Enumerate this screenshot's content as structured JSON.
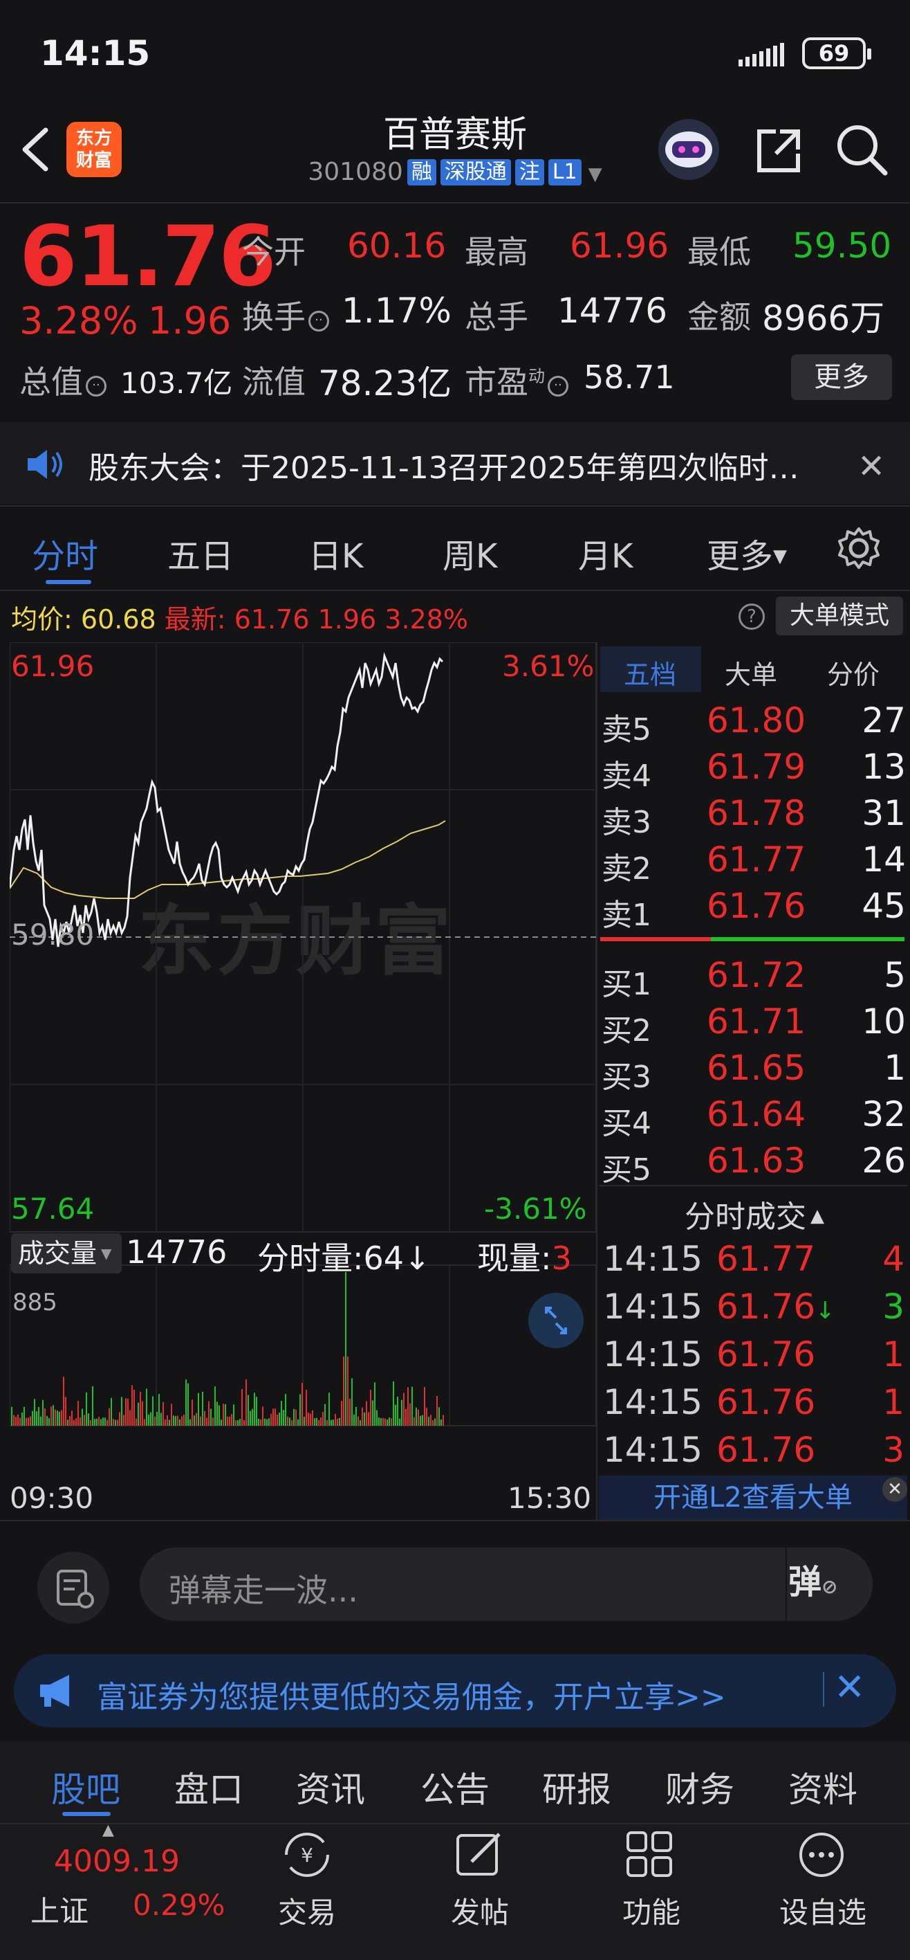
{
  "status_bar": {
    "time": "14:15",
    "battery": "69"
  },
  "header": {
    "title": "百普赛斯",
    "code": "301080",
    "tags": [
      "融",
      "深股通",
      "注",
      "L1"
    ],
    "logo_line1": "东方",
    "logo_line2": "财富"
  },
  "quote": {
    "price": "61.76",
    "change_pct": "3.28%",
    "change_amt": "1.96",
    "open_label": "今开",
    "open": "60.16",
    "high_label": "最高",
    "high": "61.96",
    "low_label": "最低",
    "low": "59.50",
    "turnover_label": "换手",
    "turnover": "1.17%",
    "volume_label": "总手",
    "volume": "14776",
    "amount_label": "金额",
    "amount": "8966万",
    "mktcap_label": "总值",
    "mktcap": "103.7亿",
    "float_label": "流值",
    "float": "78.23亿",
    "pe_label": "市盈",
    "pe_sup": "动",
    "pe": "58.71",
    "more": "更多"
  },
  "notice": {
    "text": "股东大会：于2025-11-13召开2025年第四次临时…"
  },
  "tabs": [
    "分时",
    "五日",
    "日K",
    "周K",
    "月K",
    "更多"
  ],
  "chart_bar": {
    "avg_label": "均价:",
    "avg": "60.68",
    "latest_label": "最新:",
    "latest": "61.76",
    "latest_chg": "1.96",
    "latest_pct": "3.28%",
    "big_order_mode": "大单模式"
  },
  "chart_axis": {
    "top_price": "61.96",
    "top_pct": "3.61%",
    "mid_price": "59.80",
    "bottom_price": "57.64",
    "bottom_pct": "-3.61%",
    "watermark": "东方财富",
    "vol_max": "885",
    "time_start": "09:30",
    "time_end": "15:30"
  },
  "vol_bar": {
    "selector": "成交量",
    "total": "14776",
    "minute_label": "分时量:64↓",
    "now_label": "现量:",
    "now": "3"
  },
  "orderbook": {
    "tabs": [
      "五档",
      "大单",
      "分价"
    ],
    "asks": [
      {
        "label": "卖5",
        "price": "61.80",
        "vol": "27"
      },
      {
        "label": "卖4",
        "price": "61.79",
        "vol": "13"
      },
      {
        "label": "卖3",
        "price": "61.78",
        "vol": "31"
      },
      {
        "label": "卖2",
        "price": "61.77",
        "vol": "14"
      },
      {
        "label": "卖1",
        "price": "61.76",
        "vol": "45"
      }
    ],
    "bids": [
      {
        "label": "买1",
        "price": "61.72",
        "vol": "5"
      },
      {
        "label": "买2",
        "price": "61.71",
        "vol": "10"
      },
      {
        "label": "买3",
        "price": "61.65",
        "vol": "1"
      },
      {
        "label": "买4",
        "price": "61.64",
        "vol": "32"
      },
      {
        "label": "买5",
        "price": "61.63",
        "vol": "26"
      }
    ],
    "ticks_title": "分时成交",
    "ticks": [
      {
        "time": "14:15",
        "price": "61.77",
        "vol": "4",
        "dir": ""
      },
      {
        "time": "14:15",
        "price": "61.76",
        "vol": "3",
        "dir": "↓"
      },
      {
        "time": "14:15",
        "price": "61.76",
        "vol": "1",
        "dir": ""
      },
      {
        "time": "14:15",
        "price": "61.76",
        "vol": "1",
        "dir": ""
      },
      {
        "time": "14:15",
        "price": "61.76",
        "vol": "3",
        "dir": ""
      }
    ],
    "l2_cta": "开通L2查看大单"
  },
  "comment": {
    "placeholder": "弹幕走一波...",
    "danmu": "弹"
  },
  "promo": {
    "text": "富证券为您提供更低的交易佣金，开户立享>>"
  },
  "bottom_tabs": [
    "股吧",
    "盘口",
    "资讯",
    "公告",
    "研报",
    "财务",
    "资料"
  ],
  "bottom_nav": {
    "index_value": "4009.19",
    "index_name": "上证",
    "index_pct": "0.29%",
    "items": [
      "交易",
      "发帖",
      "功能",
      "设自选"
    ]
  },
  "colors": {
    "up": "#ee2b2b",
    "down": "#1fbf2a",
    "accent": "#3b7ae0",
    "avg_line": "#f0d84a"
  }
}
